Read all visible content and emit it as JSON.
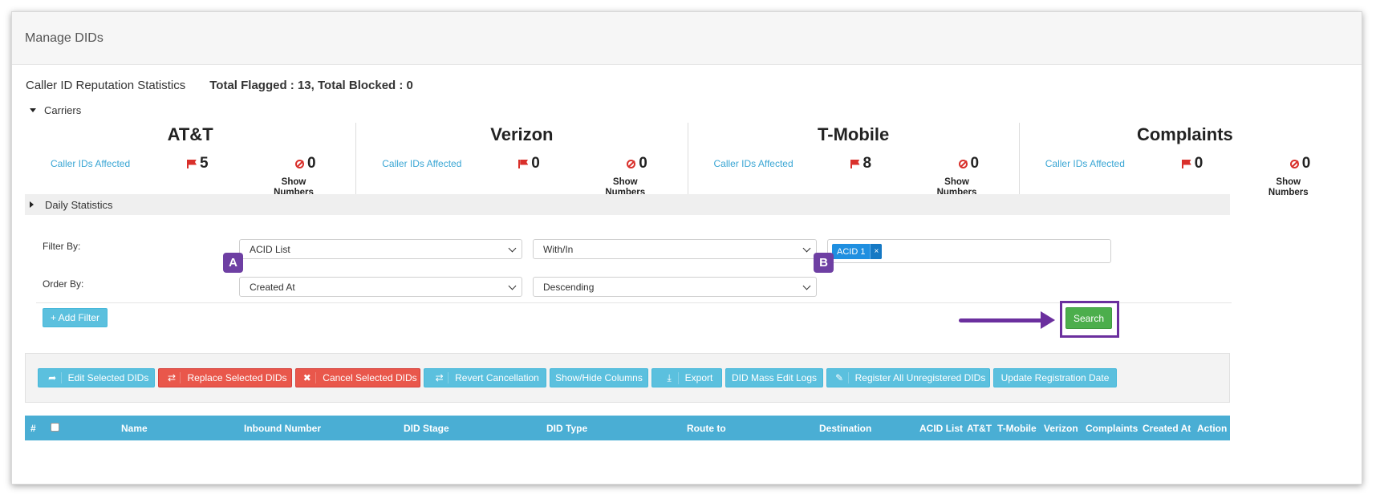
{
  "page": {
    "title": "Manage DIDs"
  },
  "stats": {
    "label": "Caller ID Reputation Statistics",
    "totals": "Total Flagged : 13, Total Blocked : 0"
  },
  "carriers_section": {
    "label": "Carriers"
  },
  "carriers": [
    {
      "name": "AT&T",
      "affected_label": "Caller IDs Affected",
      "flagged": "5",
      "blocked": "0",
      "show_numbers": "Show Numbers"
    },
    {
      "name": "Verizon",
      "affected_label": "Caller IDs Affected",
      "flagged": "0",
      "blocked": "0",
      "show_numbers": "Show Numbers"
    },
    {
      "name": "T-Mobile",
      "affected_label": "Caller IDs Affected",
      "flagged": "8",
      "blocked": "0",
      "show_numbers": "Show Numbers"
    },
    {
      "name": "Complaints",
      "affected_label": "Caller IDs Affected",
      "flagged": "0",
      "blocked": "0",
      "show_numbers": "Show Numbers"
    }
  ],
  "daily": {
    "label": "Daily Statistics"
  },
  "filters": {
    "filter_by_label": "Filter By:",
    "filter_field": "ACID List",
    "filter_operator": "With/In",
    "filter_tag": "ACID 1",
    "tag_remove": "×",
    "order_by_label": "Order By:",
    "order_field": "Created At",
    "order_direction": "Descending",
    "add_filter": "+ Add Filter",
    "search": "Search"
  },
  "annotations": {
    "a": "A",
    "b": "B",
    "highlight_color": "#6b2f9e"
  },
  "actions": [
    {
      "label": "Edit Selected DIDs",
      "icon": "share-icon"
    },
    {
      "label": "Replace Selected DIDs",
      "icon": "retweet-icon"
    },
    {
      "label": "Cancel Selected DIDs",
      "icon": "close-icon"
    },
    {
      "label": "Revert Cancellation",
      "icon": "retweet-icon"
    },
    {
      "label": "Show/Hide Columns",
      "icon": ""
    },
    {
      "label": "Export",
      "icon": "download-icon"
    },
    {
      "label": "DID Mass Edit Logs",
      "icon": ""
    },
    {
      "label": "Register All Unregistered DIDs",
      "icon": "edit-icon"
    },
    {
      "label": "Update Registration Date",
      "icon": ""
    }
  ],
  "table": {
    "columns": [
      "#",
      "Name",
      "Inbound Number",
      "DID Stage",
      "DID Type",
      "Route to",
      "Destination",
      "ACID List",
      "AT&T",
      "T-Mobile",
      "Verizon",
      "Complaints",
      "Created At",
      "Action"
    ]
  },
  "colors": {
    "info": "#5bc0de",
    "danger": "#e9574b",
    "success": "#4cae4c",
    "table_header": "#4aaed4",
    "link": "#3aa6d4",
    "flag": "#d9302b"
  }
}
